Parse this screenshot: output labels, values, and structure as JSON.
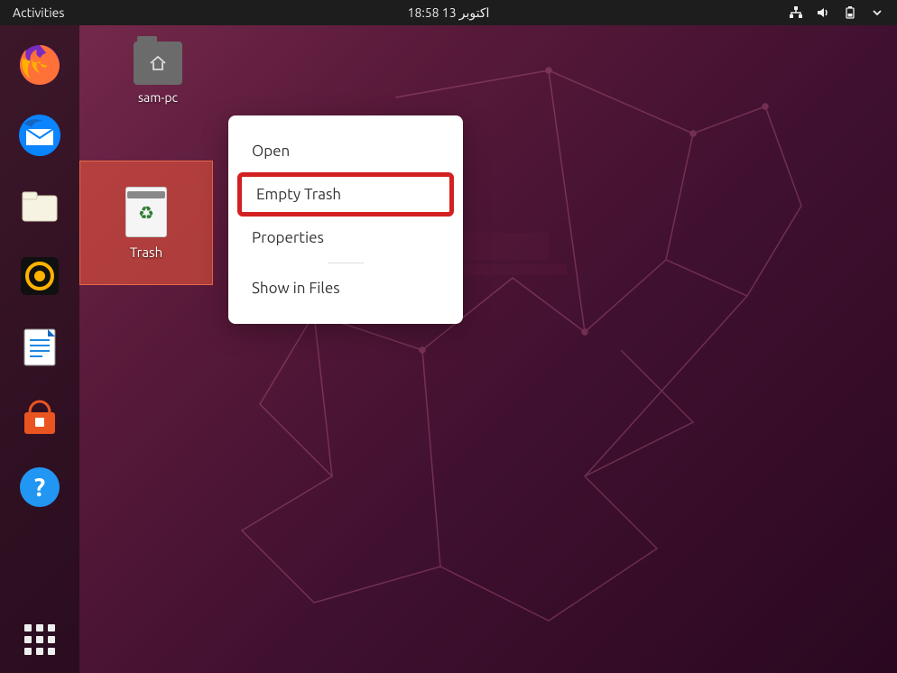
{
  "topbar": {
    "activities_label": "Activities",
    "datetime": "اكتوبر  13   18:58"
  },
  "dock": {
    "items": [
      {
        "name": "firefox",
        "color": "#ff7139"
      },
      {
        "name": "thunderbird",
        "color": "#1e88e5"
      },
      {
        "name": "files",
        "color": "#f7f3e3"
      },
      {
        "name": "rhythmbox",
        "color": "#101010"
      },
      {
        "name": "libreoffice-writer",
        "color": "#ffffff"
      },
      {
        "name": "ubuntu-software",
        "color": "#e95420"
      },
      {
        "name": "help",
        "color": "#2196f3"
      }
    ]
  },
  "desktop": {
    "home_folder_label": "sam-pc",
    "trash_label": "Trash"
  },
  "context_menu": {
    "items": [
      {
        "label": "Open",
        "highlighted": false
      },
      {
        "label": "Empty Trash",
        "highlighted": true
      },
      {
        "label": "Properties",
        "highlighted": false
      },
      {
        "label": "Show in Files",
        "highlighted": false
      }
    ]
  }
}
